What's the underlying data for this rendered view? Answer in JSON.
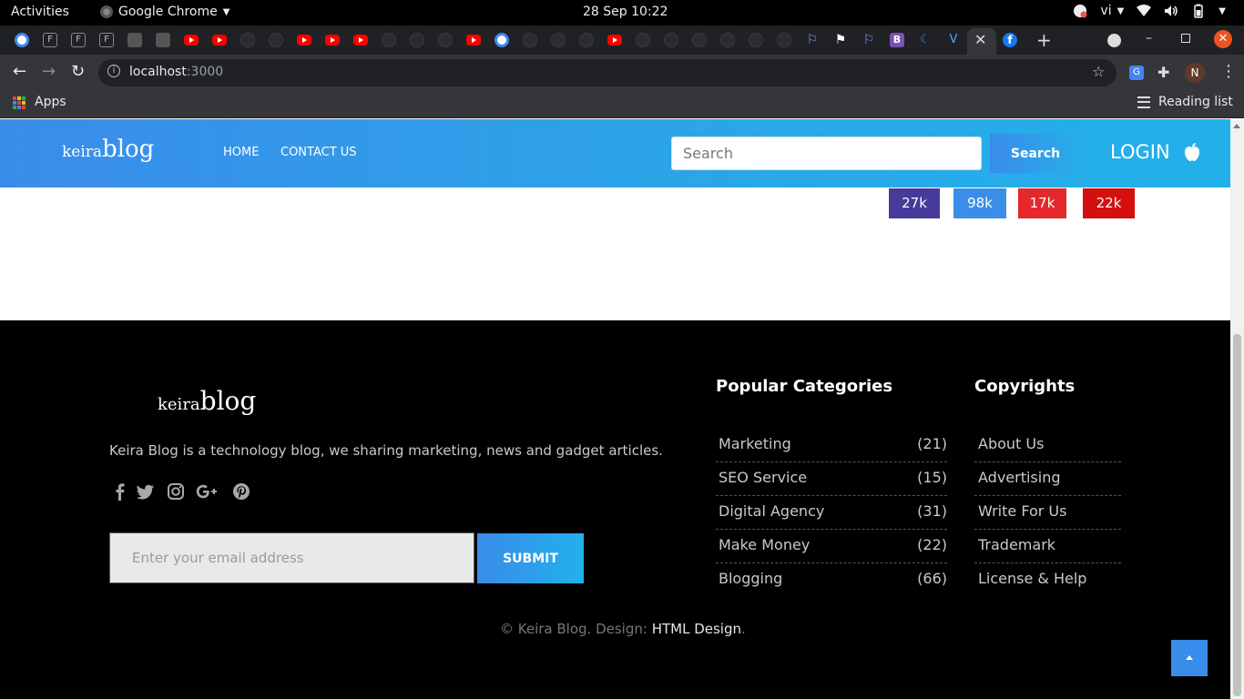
{
  "system": {
    "activities": "Activities",
    "app_name": "Google Chrome",
    "clock": "28 Sep  10:22",
    "lang": "vi"
  },
  "browser": {
    "url_host": "localhost",
    "url_port": ":3000",
    "info_glyph": "i",
    "avatar_initial": "N",
    "translate_glyph": "G",
    "apps_label": "Apps",
    "reading_list_label": "Reading list",
    "tab_close_glyph": "✕",
    "new_tab_glyph": "+",
    "win_min_glyph": "–",
    "win_close_glyph": "✕",
    "back_glyph": "←",
    "forward_glyph": "→",
    "reload_glyph": "↻",
    "star_glyph": "☆",
    "puzzle_glyph": "✚",
    "kebab_glyph": "⋮",
    "tab_favicons": [
      "google",
      "f",
      "f",
      "f",
      "misc",
      "misc",
      "youtube",
      "youtube",
      "github",
      "github",
      "youtube",
      "youtube",
      "youtube",
      "github",
      "github",
      "github",
      "youtube",
      "google",
      "github",
      "github",
      "github",
      "youtube",
      "github",
      "github",
      "github",
      "github",
      "github",
      "github",
      "flag",
      "flag-black",
      "flag",
      "bootstrap",
      "moon",
      "v",
      "active",
      "facebook"
    ],
    "tab_glyphs": {
      "f": "F",
      "flag": "⚐",
      "flag-black": "⚑",
      "bootstrap": "B",
      "moon": "☾",
      "v": "V",
      "facebook": "f"
    }
  },
  "header": {
    "logo_small": "keira",
    "logo_big": "blog",
    "nav": [
      "HOME",
      "CONTACT US"
    ],
    "search_placeholder": "Search",
    "search_button": "Search",
    "login": "LOGIN"
  },
  "social_counts": [
    {
      "value": "27k",
      "color": "#463b9a"
    },
    {
      "value": "98k",
      "color": "#3b8ee8"
    },
    {
      "value": "17k",
      "color": "#e5282c"
    },
    {
      "value": "22k",
      "color": "#d40f10"
    }
  ],
  "footer": {
    "logo_small": "keira",
    "logo_big": "blog",
    "description": "Keira Blog is a technology blog, we sharing marketing, news and gadget articles.",
    "social_icons": [
      "facebook-icon",
      "twitter-icon",
      "instagram-icon",
      "google-plus-icon",
      "pinterest-icon"
    ],
    "email_placeholder": "Enter your email address",
    "submit": "SUBMIT",
    "popular_title": "Popular Categories",
    "categories": [
      {
        "name": "Marketing",
        "count": "(21)"
      },
      {
        "name": "SEO Service",
        "count": "(15)"
      },
      {
        "name": "Digital Agency",
        "count": "(31)"
      },
      {
        "name": "Make Money",
        "count": "(22)"
      },
      {
        "name": "Blogging",
        "count": "(66)"
      }
    ],
    "copyrights_title": "Copyrights",
    "copyright_links": [
      "About Us",
      "Advertising",
      "Write For Us",
      "Trademark",
      "License & Help"
    ],
    "copyright_text": "© Keira Blog. Design: ",
    "copyright_link": "HTML Design",
    "copyright_end": "."
  },
  "colors": {
    "header_gradient_start": "#3a8cea",
    "header_gradient_end": "#22b0ea",
    "footer_bg": "#000000",
    "back_to_top": "#3a8cea"
  }
}
